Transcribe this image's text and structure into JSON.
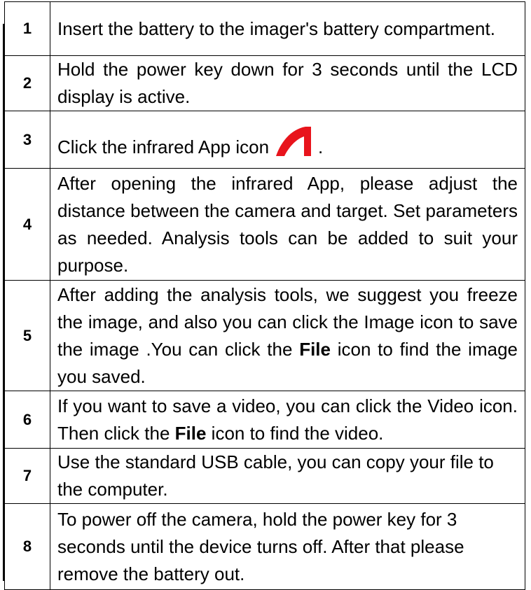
{
  "steps": [
    {
      "num": "1",
      "text": "Insert the battery to the imager's battery compartment."
    },
    {
      "num": "2",
      "text": "Hold the power key down for 3 seconds until the LCD display is active."
    },
    {
      "num": "3",
      "text_before": "Click the infrared App icon",
      "text_after": ".",
      "icon": "infrared-app-icon",
      "icon_color": "#e8141c"
    },
    {
      "num": "4",
      "text": "After opening the infrared App, please adjust the distance between the camera and target. Set parameters as needed. Analysis tools can be added to suit your purpose."
    },
    {
      "num": "5",
      "text_a": "After adding the analysis tools, we suggest you freeze the image, and also you can click the Image icon to save the image .You can click the ",
      "bold": "File",
      "text_b": " icon to find the image you saved."
    },
    {
      "num": "6",
      "text_a": "If you want to save a video, you can click the Video icon. Then click the ",
      "bold": "File",
      "text_b": " icon to find the video."
    },
    {
      "num": "7",
      "text": "Use the standard USB cable, you can copy your file to the computer."
    },
    {
      "num": "8",
      "text": "To power off the camera, hold the power key for 3 seconds until the device turns off. After that please remove the battery out."
    }
  ]
}
